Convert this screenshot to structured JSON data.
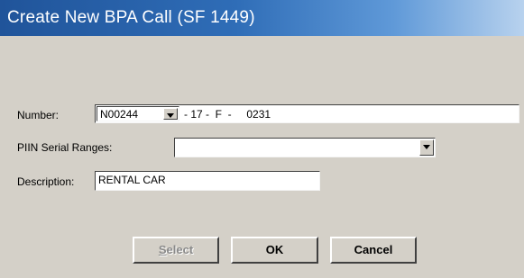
{
  "window": {
    "title": "Create New BPA Call (SF 1449)"
  },
  "form": {
    "number": {
      "label": "Number:",
      "prefix_value": "N00244",
      "segment_text": "- 17 -  F  -     0231"
    },
    "piin": {
      "label": "PIIN Serial Ranges:",
      "value": ""
    },
    "description": {
      "label": "Description:",
      "value": "RENTAL CAR"
    }
  },
  "buttons": {
    "select_label": "Select",
    "ok_label": "OK",
    "cancel_label": "Cancel"
  },
  "colors": {
    "dialog_bg": "#d4d0c8",
    "titlebar": "#2f6db7",
    "title_text": "#ffffff"
  }
}
